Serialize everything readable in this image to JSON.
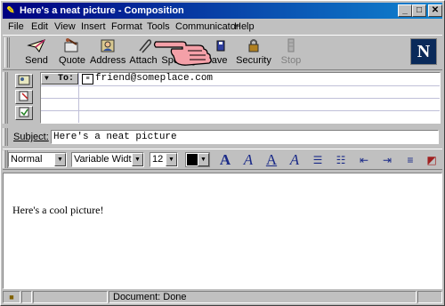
{
  "window": {
    "title": "Here's a neat picture - Composition",
    "controls": {
      "minimize": "_",
      "maximize": "□",
      "close": "✕"
    }
  },
  "menu": [
    {
      "label": "File"
    },
    {
      "label": "Edit"
    },
    {
      "label": "View"
    },
    {
      "label": "Insert"
    },
    {
      "label": "Format"
    },
    {
      "label": "Tools"
    },
    {
      "label": "Communicator"
    },
    {
      "label": "Help"
    }
  ],
  "toolbar": {
    "buttons": [
      {
        "label": "Send",
        "icon": "send-icon"
      },
      {
        "label": "Quote",
        "icon": "quote-icon"
      },
      {
        "label": "Address",
        "icon": "address-book-icon"
      },
      {
        "label": "Attach",
        "icon": "paperclip-icon"
      },
      {
        "label": "Spelling",
        "icon": "spelling-icon"
      },
      {
        "label": "Save",
        "icon": "save-icon"
      },
      {
        "label": "Security",
        "icon": "lock-icon"
      },
      {
        "label": "Stop",
        "icon": "stop-icon",
        "disabled": true
      }
    ],
    "brand_logo": "N"
  },
  "address": {
    "to_label": "To:",
    "recipient": "friend@someplace.com"
  },
  "subject": {
    "label": "Subject:",
    "value": "Here's a neat picture"
  },
  "format": {
    "paragraph_style": "Normal",
    "font": "Variable Width",
    "size": "12",
    "text_color": "#000000"
  },
  "body": {
    "text": "Here's a cool picture!"
  },
  "status": {
    "text": "Document: Done"
  },
  "colors": {
    "title_gradient_start": "#000080",
    "title_gradient_end": "#1084d0",
    "chrome": "#c0c0c0",
    "format_icons": "#1a2a88"
  }
}
